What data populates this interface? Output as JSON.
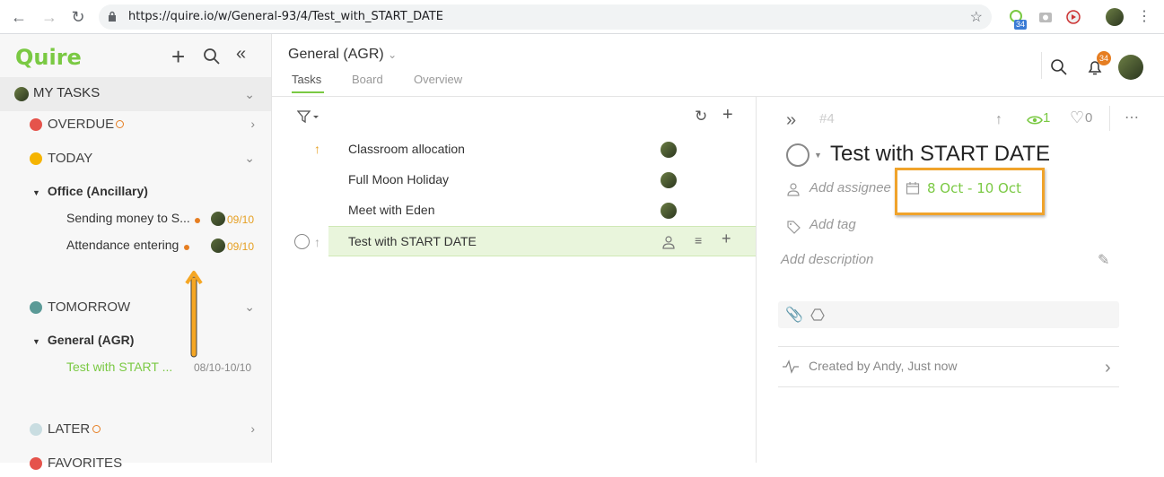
{
  "browser": {
    "url": "https://quire.io/w/General-93/4/Test_with_START_DATE",
    "ext_badge": "34"
  },
  "sidebar": {
    "logo": "Quire",
    "my_tasks": "MY TASKS",
    "sections": {
      "overdue": {
        "label": "OVERDUE",
        "color": "#e5534b"
      },
      "today": {
        "label": "TODAY",
        "color": "#f5b400"
      },
      "tomorrow": {
        "label": "TOMORROW",
        "color": "#5b9a97"
      },
      "later": {
        "label": "LATER",
        "color": "#c9dde1"
      },
      "favorites": {
        "label": "FAVORITES",
        "color": "#e5534b"
      }
    },
    "today_group": "Office (Ancillary)",
    "today_tasks": [
      {
        "name": "Sending money to S...",
        "date": "09/10"
      },
      {
        "name": "Attendance entering",
        "date": "09/10"
      }
    ],
    "tomorrow_group": "General (AGR)",
    "tomorrow_task": {
      "name": "Test with START ...",
      "date": "08/10-10/10"
    }
  },
  "main": {
    "project_title": "General (AGR)",
    "tabs": [
      "Tasks",
      "Board",
      "Overview"
    ],
    "notif_count": "34"
  },
  "list": {
    "tasks": [
      "Classroom allocation",
      "Full Moon Holiday",
      "Meet with Eden",
      "Test with START DATE"
    ]
  },
  "detail": {
    "task_id": "#4",
    "watchers": "1",
    "likes": "0",
    "title": "Test with START DATE",
    "add_assignee": "Add assignee",
    "date_range": "8 Oct - 10 Oct",
    "add_tag": "Add tag",
    "add_description": "Add description",
    "created": "Created by Andy, Just now"
  }
}
